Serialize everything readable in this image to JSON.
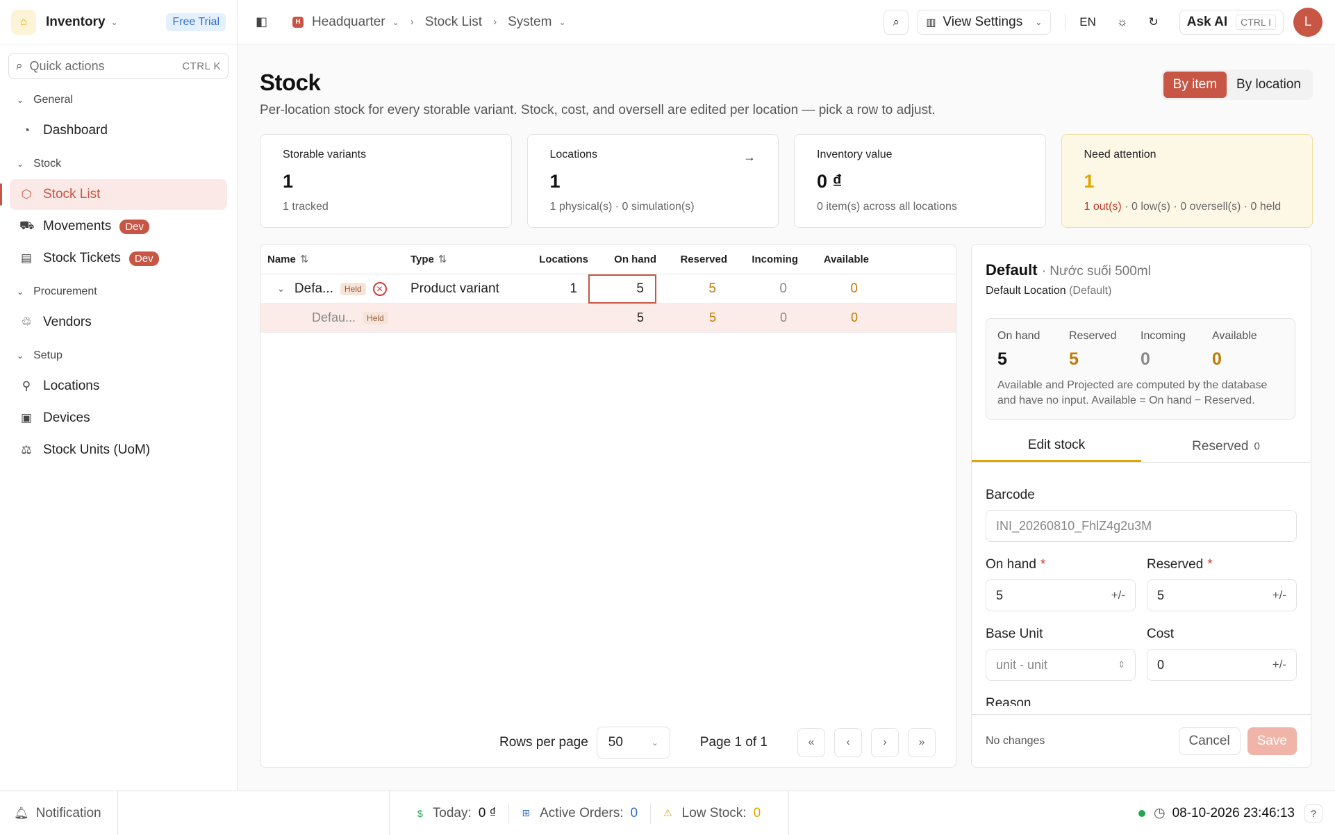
{
  "sidebar": {
    "app_name": "Inventory",
    "trial_badge": "Free Trial",
    "quick_actions": {
      "placeholder": "Quick actions",
      "shortcut": "CTRL K"
    },
    "groups": {
      "general": "General",
      "stock": "Stock",
      "procurement": "Procurement",
      "setup": "Setup"
    },
    "items": {
      "dashboard": "Dashboard",
      "stock_list": "Stock List",
      "movements": "Movements",
      "stock_tickets": "Stock Tickets",
      "vendors": "Vendors",
      "locations": "Locations",
      "devices": "Devices",
      "stock_units": "Stock Units (UoM)"
    },
    "dev_badge": "Dev"
  },
  "topbar": {
    "breadcrumb": {
      "headquarter": "Headquarter",
      "hq_initial": "H",
      "stock_list": "Stock List",
      "system": "System"
    },
    "view_settings": "View Settings",
    "language": "EN",
    "ask_ai": "Ask AI",
    "ask_ai_shortcut": "CTRL I",
    "avatar_initial": "L"
  },
  "page": {
    "title": "Stock",
    "subtitle": "Per-location stock for every storable variant. Stock, cost, and oversell are edited per location — pick a row to adjust.",
    "view_toggle": {
      "by_item": "By item",
      "by_location": "By location"
    }
  },
  "stats": {
    "variants": {
      "label": "Storable variants",
      "value": "1",
      "sub": "1 tracked"
    },
    "locations": {
      "label": "Locations",
      "value": "1",
      "sub": "1 physical(s) · 0 simulation(s)"
    },
    "inventory_value": {
      "label": "Inventory value",
      "value": "0 ₫",
      "sub": "0 item(s) across all locations"
    },
    "attention": {
      "label": "Need attention",
      "value": "1",
      "sub_out": "1 out(s)",
      "sub_rest": " · 0 low(s) · 0 oversell(s) · 0 held"
    }
  },
  "table": {
    "headers": {
      "name": "Name",
      "type": "Type",
      "locations": "Locations",
      "on_hand": "On hand",
      "reserved": "Reserved",
      "incoming": "Incoming",
      "available": "Available"
    },
    "held_badge": "Held",
    "rows": [
      {
        "name": "Defa...",
        "type": "Product variant",
        "locations": "1",
        "on_hand": "5",
        "reserved": "5",
        "incoming": "0",
        "available": "0"
      },
      {
        "name": "Defau...",
        "type": "",
        "locations": "",
        "on_hand": "5",
        "reserved": "5",
        "incoming": "0",
        "available": "0"
      }
    ],
    "pager": {
      "rows_per_page_label": "Rows per page",
      "rows_per_page": "50",
      "page_info": "Page 1 of 1"
    }
  },
  "panel": {
    "title": "Default",
    "title_sub": "· Nước suối 500ml",
    "location": "Default Location",
    "location_tag": "(Default)",
    "summary": {
      "on_hand_label": "On hand",
      "on_hand": "5",
      "reserved_label": "Reserved",
      "reserved": "5",
      "incoming_label": "Incoming",
      "incoming": "0",
      "available_label": "Available",
      "available": "0",
      "note": "Available and Projected are computed by the database and have no input. Available = On hand − Reserved."
    },
    "tabs": {
      "edit_stock": "Edit stock",
      "reserved": "Reserved",
      "reserved_count": "0"
    },
    "form": {
      "barcode_label": "Barcode",
      "barcode_value": "INI_20260810_FhlZ4g2u3M",
      "on_hand_label": "On hand",
      "on_hand_value": "5",
      "reserved_label": "Reserved",
      "reserved_value": "5",
      "required_mark": "*",
      "adjust_hint": "+/-",
      "base_unit_label": "Base Unit",
      "base_unit_value": "unit - unit",
      "cost_label": "Cost",
      "cost_value": "0",
      "reason_label": "Reason"
    },
    "footer": {
      "status": "No changes",
      "cancel": "Cancel",
      "save": "Save"
    }
  },
  "statusbar": {
    "notification": "Notification",
    "today_label": "Today:",
    "today_value": "0 ₫",
    "orders_label": "Active Orders:",
    "orders_value": "0",
    "low_stock_label": "Low Stock:",
    "low_stock_value": "0",
    "datetime": "08-10-2026 23:46:13"
  },
  "colors": {
    "accent": "#c75644",
    "warning": "#e0a500",
    "success": "#22a652",
    "info": "#2f6fcc"
  }
}
